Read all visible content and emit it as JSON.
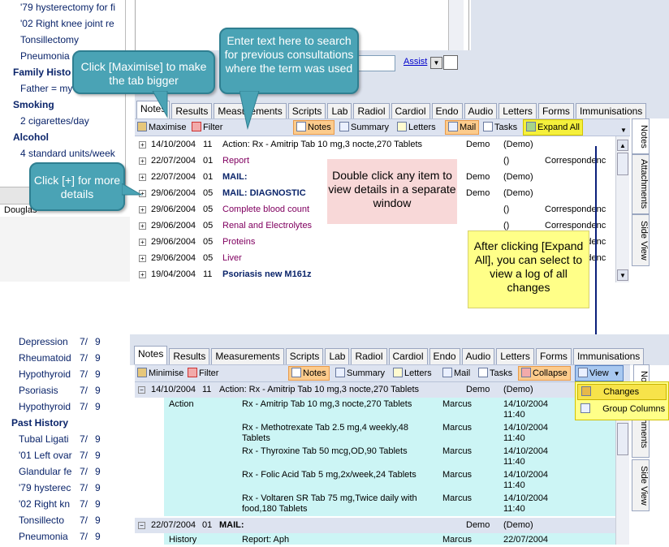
{
  "top_panel": {
    "left_items": [
      {
        "text": "'79 hysterectomy for fi",
        "style": "item"
      },
      {
        "text": "'02 Right knee joint re",
        "style": "item"
      },
      {
        "text": "Tonsillectomy",
        "style": "item"
      },
      {
        "text": "Pneumonia",
        "style": "item"
      },
      {
        "text": "Family Histo",
        "style": "head"
      },
      {
        "text": "Father = my",
        "style": "item"
      },
      {
        "text": "Smoking",
        "style": "head"
      },
      {
        "text": "2 cigarettes/day",
        "style": "item"
      },
      {
        "text": "Alcohol",
        "style": "head"
      },
      {
        "text": "4 standard units/week",
        "style": "item"
      }
    ],
    "status_text": "Douglas",
    "assist_label": "Assist",
    "tabs": [
      "Notes",
      "Results",
      "Measurements",
      "Scripts",
      "Lab",
      "Radiol",
      "Cardiol",
      "Endo",
      "Audio",
      "Letters",
      "Forms",
      "Immunisations"
    ],
    "toolbar": {
      "maximise": "Maximise",
      "filter": "Filter",
      "notes": "Notes",
      "summary": "Summary",
      "letters": "Letters",
      "mail": "Mail",
      "tasks": "Tasks",
      "expand_all": "Expand All"
    },
    "rows": [
      {
        "date": "14/10/2004",
        "num": "11",
        "desc": "Action: Rx - Amitrip Tab 10 mg,3 nocte,270 Tablets",
        "user": "Demo",
        "who": "(Demo)",
        "cat": ""
      },
      {
        "date": "22/07/2004",
        "num": "01",
        "desc": "Report",
        "user": "",
        "who": "()",
        "cat": "Correspondenc"
      },
      {
        "date": "22/07/2004",
        "num": "01",
        "desc": "MAIL:",
        "user": "Demo",
        "who": "(Demo)",
        "cat": ""
      },
      {
        "date": "29/06/2004",
        "num": "05",
        "desc": "MAIL: DIAGNOSTIC",
        "user": "Demo",
        "who": "(Demo)",
        "cat": ""
      },
      {
        "date": "29/06/2004",
        "num": "05",
        "desc": "Complete blood count",
        "user": "",
        "who": "()",
        "cat": "Correspondenc"
      },
      {
        "date": "29/06/2004",
        "num": "05",
        "desc": "Renal and Electrolytes",
        "user": "",
        "who": "()",
        "cat": "Correspondenc"
      },
      {
        "date": "29/06/2004",
        "num": "05",
        "desc": "Proteins",
        "user": "",
        "who": "()",
        "cat": "Correspondenc"
      },
      {
        "date": "29/06/2004",
        "num": "05",
        "desc": "Liver",
        "user": "",
        "who": "()",
        "cat": "Correspondenc"
      },
      {
        "date": "19/04/2004",
        "num": "11",
        "desc": "Psoriasis new M161z",
        "user": "",
        "who": "",
        "cat": ""
      }
    ],
    "side_tabs": [
      "Notes",
      "Attachments",
      "Side View"
    ]
  },
  "callouts": {
    "maximise": "Click [Maximise] to make the tab bigger",
    "search": "Enter text here to search for previous consultations where the term was used",
    "details": "Click [+] for more details",
    "double_click": "Double click any item to view details in a separate window",
    "expand_all": "After clicking [Expand All], you can select to view a log of all changes"
  },
  "bottom_panel": {
    "left_items": [
      {
        "text": "Depression",
        "a": "7/",
        "b": "9",
        "style": "item"
      },
      {
        "text": "Rheumatoid",
        "a": "7/",
        "b": "9",
        "style": "item"
      },
      {
        "text": "Hypothyroid",
        "a": "7/",
        "b": "9",
        "style": "item"
      },
      {
        "text": "Psoriasis",
        "a": "7/",
        "b": "9",
        "style": "item"
      },
      {
        "text": "Hypothyroid",
        "a": "7/",
        "b": "9",
        "style": "item"
      },
      {
        "text": "Past History",
        "a": "",
        "b": "",
        "style": "head"
      },
      {
        "text": "Tubal Ligati",
        "a": "7/",
        "b": "9",
        "style": "item"
      },
      {
        "text": "'01 Left ovar",
        "a": "7/",
        "b": "9",
        "style": "item"
      },
      {
        "text": "Glandular fe",
        "a": "7/",
        "b": "9",
        "style": "item"
      },
      {
        "text": "'79 hysterec",
        "a": "7/",
        "b": "9",
        "style": "item"
      },
      {
        "text": "'02 Right kn",
        "a": "7/",
        "b": "9",
        "style": "item"
      },
      {
        "text": "Tonsillecto",
        "a": "7/",
        "b": "9",
        "style": "item"
      },
      {
        "text": "Pneumonia",
        "a": "7/",
        "b": "9",
        "style": "item"
      }
    ],
    "tabs": [
      "Notes",
      "Results",
      "Measurements",
      "Scripts",
      "Lab",
      "Radiol",
      "Cardiol",
      "Endo",
      "Audio",
      "Letters",
      "Forms",
      "Immunisations"
    ],
    "toolbar": {
      "minimise": "Minimise",
      "filter": "Filter",
      "notes": "Notes",
      "summary": "Summary",
      "letters": "Letters",
      "mail": "Mail",
      "tasks": "Tasks",
      "collapse": "Collapse",
      "view": "View"
    },
    "view_menu": [
      "Changes",
      "Group Columns"
    ],
    "group1": {
      "date": "14/10/2004",
      "num": "11",
      "desc": "Action: Rx - Amitrip Tab 10 mg,3 nocte,270 Tablets",
      "user": "Demo",
      "who": "(Demo)"
    },
    "details": [
      {
        "label": "Action",
        "l1": "Rx - Amitrip Tab 10 mg,3 nocte,270 Tablets",
        "l2": "",
        "user": "Marcus",
        "d": "14/10/2004",
        "t": "11:40"
      },
      {
        "label": "",
        "l1": "Rx - Methotrexate Tab 2.5 mg,4 weekly,48",
        "l2": "Tablets",
        "user": "Marcus",
        "d": "14/10/2004",
        "t": "11:40"
      },
      {
        "label": "",
        "l1": "Rx - Thyroxine Tab 50 mcg,OD,90 Tablets",
        "l2": "",
        "user": "Marcus",
        "d": "14/10/2004",
        "t": "11:40"
      },
      {
        "label": "",
        "l1": "Rx - Folic Acid Tab 5 mg,2x/week,24 Tablets",
        "l2": "",
        "user": "Marcus",
        "d": "14/10/2004",
        "t": "11:40"
      },
      {
        "label": "",
        "l1": "Rx - Voltaren SR Tab 75 mg,Twice daily with",
        "l2": "food,180 Tablets",
        "user": "Marcus",
        "d": "14/10/2004",
        "t": "11:40"
      }
    ],
    "group2": {
      "date": "22/07/2004",
      "num": "01",
      "desc": "MAIL:",
      "user": "Demo",
      "who": "(Demo)"
    },
    "last_row": {
      "label": "History",
      "desc": "Report: Aph",
      "user": "Marcus",
      "d": "22/07/2004"
    },
    "side_tabs": [
      "No",
      "Attachments",
      "Side View"
    ]
  },
  "colors": {
    "callout": "#4aa3b5",
    "yellow_note": "#ffff88",
    "pink_note": "#f8d8d8",
    "row_bg": "#ccf5f5",
    "header_bg": "#dde3f0"
  }
}
